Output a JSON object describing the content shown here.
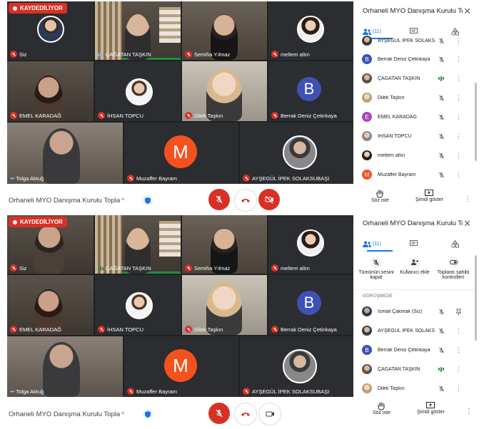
{
  "recording_label": "KAYDEDİLİYOR",
  "meeting_title": "Orhaneli MYO Danışma Kurulu Toplant...",
  "sidebar_title": "Orhaneli MYO Danışma Kurulu To...",
  "close_glyph": "✕",
  "participants_count": "(11)",
  "tiles_top": {
    "t1": "Siz",
    "t2": "ÇAĞATAN TAŞKIN",
    "t3": "Semiha Yılmaz",
    "t4": "meltem altın",
    "t5": "EMEL KARADAĞ",
    "t6": "İHSAN TOPCU",
    "t7": "Dilek Taşkın",
    "t8": "Berrak Deniz Çetinkaya",
    "t9": "Tolga Aktuğ",
    "t10": "Muzaffer Bayram",
    "t11": "AYŞEGÜL İPEK SOLAKSUBAŞI"
  },
  "tiles_bottom": {
    "t1": "Siz",
    "t2": "ÇAĞATAN TAŞKIN",
    "t3": "Semiha Yılmaz",
    "t4": "meltem altın",
    "t5": "EMEL KARADAĞ",
    "t6": "İHSAN TOPCU",
    "t7": "Dilek Taşkın",
    "t8": "Berrak Deniz Çetinkaya",
    "t9": "Tolga Aktuğ",
    "t10": "Muzaffer Bayram",
    "t11": "AYŞEGÜL İPEK SOLAKSUBAŞI"
  },
  "letters": {
    "b": "B",
    "m": "M",
    "e": "E"
  },
  "list_top": [
    {
      "name": "AYŞEGÜL İPEK SOLAKS..."
    },
    {
      "name": "Berrak Deniz Çetinkaya"
    },
    {
      "name": "ÇAĞATAN TAŞKIN"
    },
    {
      "name": "Dilek Taşkın"
    },
    {
      "name": "EMEL KARADAĞ"
    },
    {
      "name": "İHSAN TOPCU"
    },
    {
      "name": "meltem altın"
    },
    {
      "name": "Muzaffer Bayram"
    }
  ],
  "list_bottom": [
    {
      "name": "Ismail Çakmak (Siz)"
    },
    {
      "name": "AYŞEGÜL İPEK SOLAKS..."
    },
    {
      "name": "Berrak Deniz Çetinkaya"
    },
    {
      "name": "ÇAĞATAN TAŞKIN"
    },
    {
      "name": "Dilek Taşkın"
    }
  ],
  "host_controls": {
    "mute_all": "Tümünün sesini kapat",
    "add_user": "Kullanıcı ekle",
    "host_controls": "Toplantı sahibi kontrolleri"
  },
  "section_in_meeting": "GÖRÜŞMEDE",
  "raise_hand": "Söz iste",
  "present_now": "Şimdi göster",
  "more_glyph": "⋮",
  "chevron_glyph": "^",
  "colors": {
    "accent": "#1a73e8",
    "danger": "#d93025",
    "speaking": "#1e8e3e",
    "avatar_b": "#3f51b5",
    "avatar_m": "#f4511e",
    "avatar_e": "#ab47bc",
    "tile_bg": "#3c4043"
  }
}
